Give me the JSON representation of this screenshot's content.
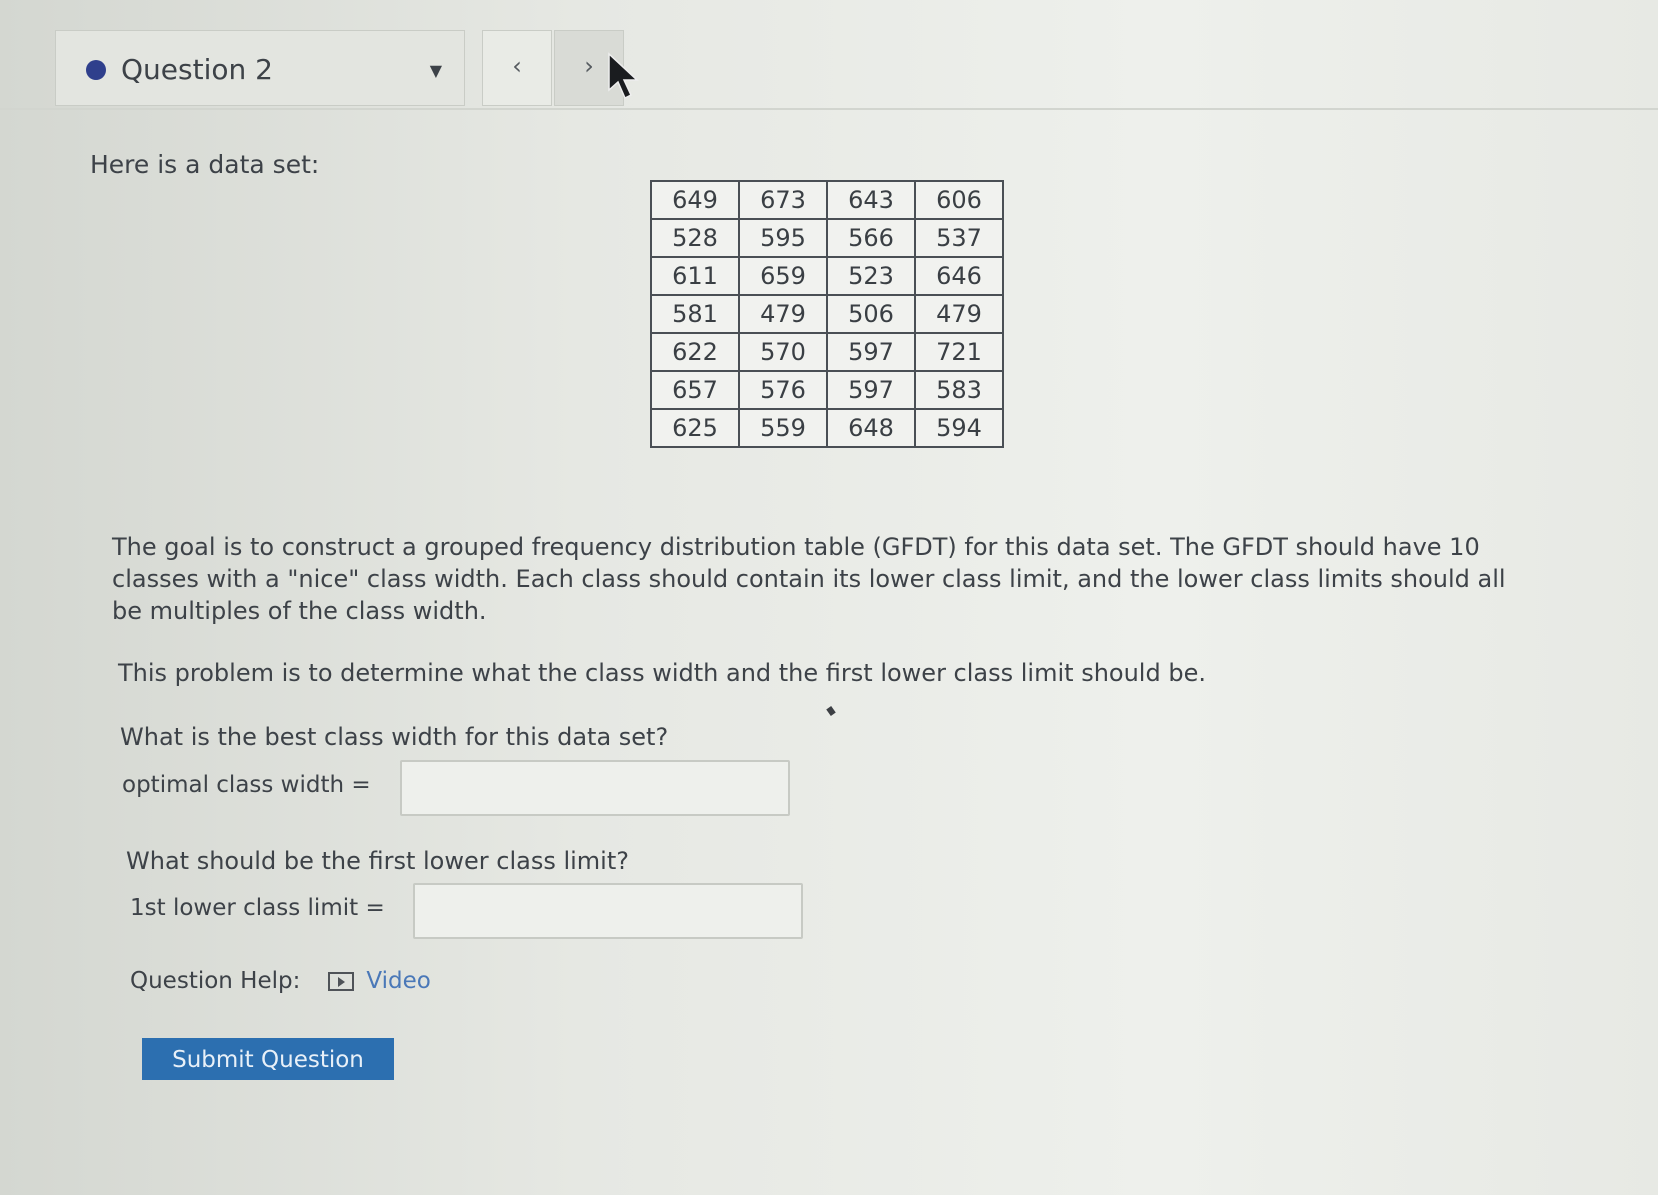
{
  "header": {
    "question_label": "Question 2",
    "dropdown_icon": "caret-down",
    "prev_label": "‹",
    "next_label": "›"
  },
  "intro": "Here is a data set:",
  "data_table": [
    [
      "649",
      "673",
      "643",
      "606"
    ],
    [
      "528",
      "595",
      "566",
      "537"
    ],
    [
      "611",
      "659",
      "523",
      "646"
    ],
    [
      "581",
      "479",
      "506",
      "479"
    ],
    [
      "622",
      "570",
      "597",
      "721"
    ],
    [
      "657",
      "576",
      "597",
      "583"
    ],
    [
      "625",
      "559",
      "648",
      "594"
    ]
  ],
  "paragraph1": "The goal is to construct a grouped frequency distribution table (GFDT) for this data set. The GFDT should have 10 classes with a \"nice\" class width. Each class should contain its lower class limit, and the lower class limits should all be multiples of the class width.",
  "paragraph2": "This problem is to determine what the class width and the first lower class limit should be.",
  "question1": {
    "prompt": "What is the best class width for this data set?",
    "field_label": "optimal class width =",
    "value": ""
  },
  "question2": {
    "prompt": "What should be the first lower class limit?",
    "field_label": "1st lower class limit =",
    "value": ""
  },
  "help": {
    "label": "Question Help:",
    "video_label": "Video"
  },
  "submit_label": "Submit Question",
  "colors": {
    "status_dot": "#2f3f8c",
    "submit_bg": "#2c6fb0",
    "link": "#4a78b8"
  }
}
